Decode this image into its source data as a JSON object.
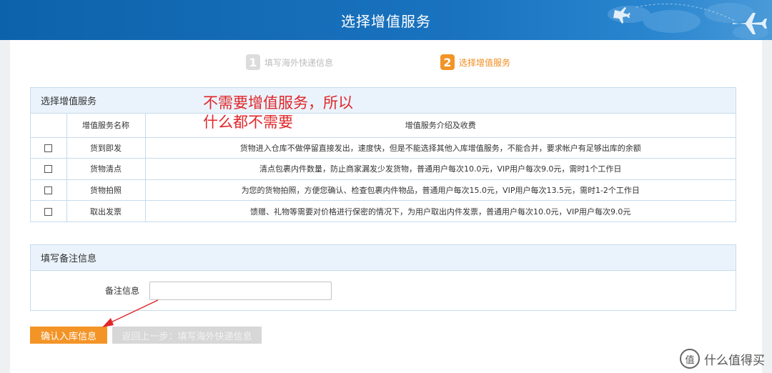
{
  "header": {
    "title": "选择增值服务"
  },
  "steps": [
    {
      "num": "1",
      "label": "填写海外快递信息",
      "state": "inactive"
    },
    {
      "num": "2",
      "label": "选择增值服务",
      "state": "active"
    }
  ],
  "services_panel": {
    "title": "选择增值服务",
    "columns": [
      "",
      "增值服务名称",
      "增值服务介绍及收费"
    ],
    "rows": [
      {
        "name": "货到即发",
        "desc": "货物进入仓库不做停留直接发出，速度快，但是不能选择其他入库增值服务，不能合并，要求帐户有足够出库的余额",
        "checked": false
      },
      {
        "name": "货物清点",
        "desc": "清点包裹内件数量，防止商家漏发少发货物，普通用户每次10.0元，VIP用户每次9.0元，需时1个工作日",
        "checked": false
      },
      {
        "name": "货物拍照",
        "desc": "为您的货物拍照，方便您确认、检查包裹内件物品，普通用户每次15.0元，VIP用户每次13.5元，需时1-2个工作日",
        "checked": false
      },
      {
        "name": "取出发票",
        "desc": "馈赠、礼物等需要对价格进行保密的情况下，为用户取出内件发票，普通用户每次10.0元，VIP用户每次9.0元",
        "checked": false
      }
    ]
  },
  "annotation": {
    "line1": "不需要增值服务，所以",
    "line2": "什么都不需要"
  },
  "remark_panel": {
    "title": "填写备注信息",
    "label": "备注信息",
    "value": "",
    "placeholder": ""
  },
  "buttons": {
    "confirm": "确认入库信息",
    "back": "返回上一步：填写海外快递信息"
  },
  "watermark": {
    "text": "什么值得买",
    "icon_glyph": "值"
  },
  "colors": {
    "header_blue": "#1a73bf",
    "accent_orange": "#f39427",
    "annotation_red": "#e0262a"
  }
}
